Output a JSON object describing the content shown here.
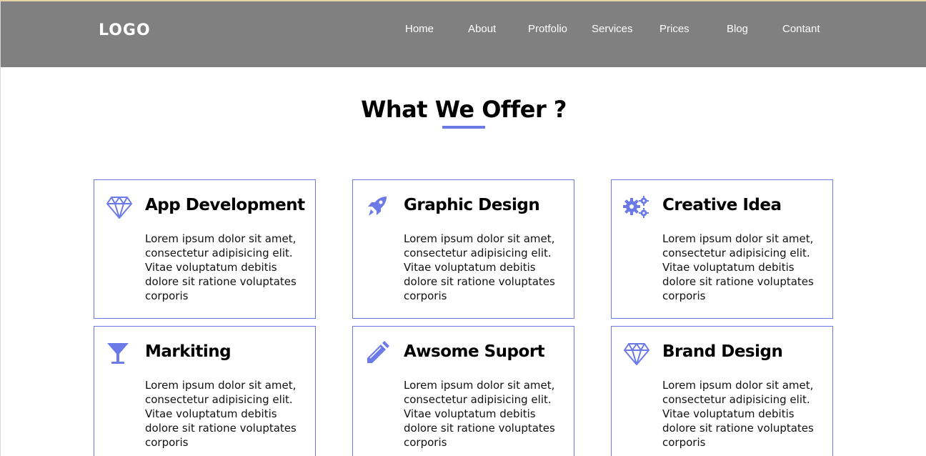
{
  "header": {
    "logo": "LOGO",
    "nav": [
      "Home",
      "About",
      "Protfolio",
      "Services",
      "Prices",
      "Blog",
      "Contant"
    ]
  },
  "section": {
    "title": "What We Offer ?"
  },
  "colors": {
    "accent": "#6c7ae8",
    "header_bg": "#808080"
  },
  "cards": [
    {
      "icon": "diamond-icon",
      "title": "App Development",
      "text": "Lorem ipsum dolor sit amet, consectetur adipisicing elit. Vitae voluptatum debitis dolore sit ratione voluptates corporis"
    },
    {
      "icon": "rocket-icon",
      "title": "Graphic Design",
      "text": "Lorem ipsum dolor sit amet, consectetur adipisicing elit. Vitae voluptatum debitis dolore sit ratione voluptates corporis"
    },
    {
      "icon": "gears-icon",
      "title": "Creative Idea",
      "text": "Lorem ipsum dolor sit amet, consectetur adipisicing elit. Vitae voluptatum debitis dolore sit ratione voluptates corporis"
    },
    {
      "icon": "cocktail-glass-icon",
      "title": "Markiting",
      "text": "Lorem ipsum dolor sit amet, consectetur adipisicing elit. Vitae voluptatum debitis dolore sit ratione voluptates corporis"
    },
    {
      "icon": "pencil-icon",
      "title": "Awsome Suport",
      "text": "Lorem ipsum dolor sit amet, consectetur adipisicing elit. Vitae voluptatum debitis dolore sit ratione voluptates corporis"
    },
    {
      "icon": "diamond-icon",
      "title": "Brand Design",
      "text": "Lorem ipsum dolor sit amet, consectetur adipisicing elit. Vitae voluptatum debitis dolore sit ratione voluptates corporis"
    }
  ]
}
